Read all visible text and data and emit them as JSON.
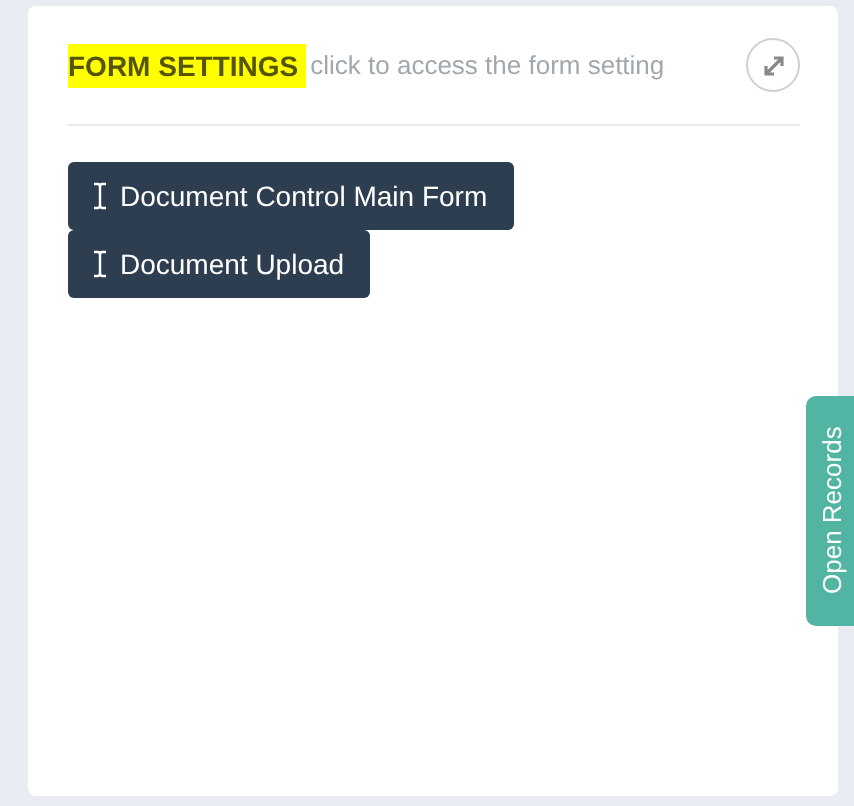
{
  "panel": {
    "title": "FORM SETTINGS",
    "subtitle": "click to access the form setting"
  },
  "forms": [
    {
      "label": "Document Control Main Form"
    },
    {
      "label": "Document Upload"
    }
  ],
  "side_tab": {
    "label": "Open Records"
  }
}
